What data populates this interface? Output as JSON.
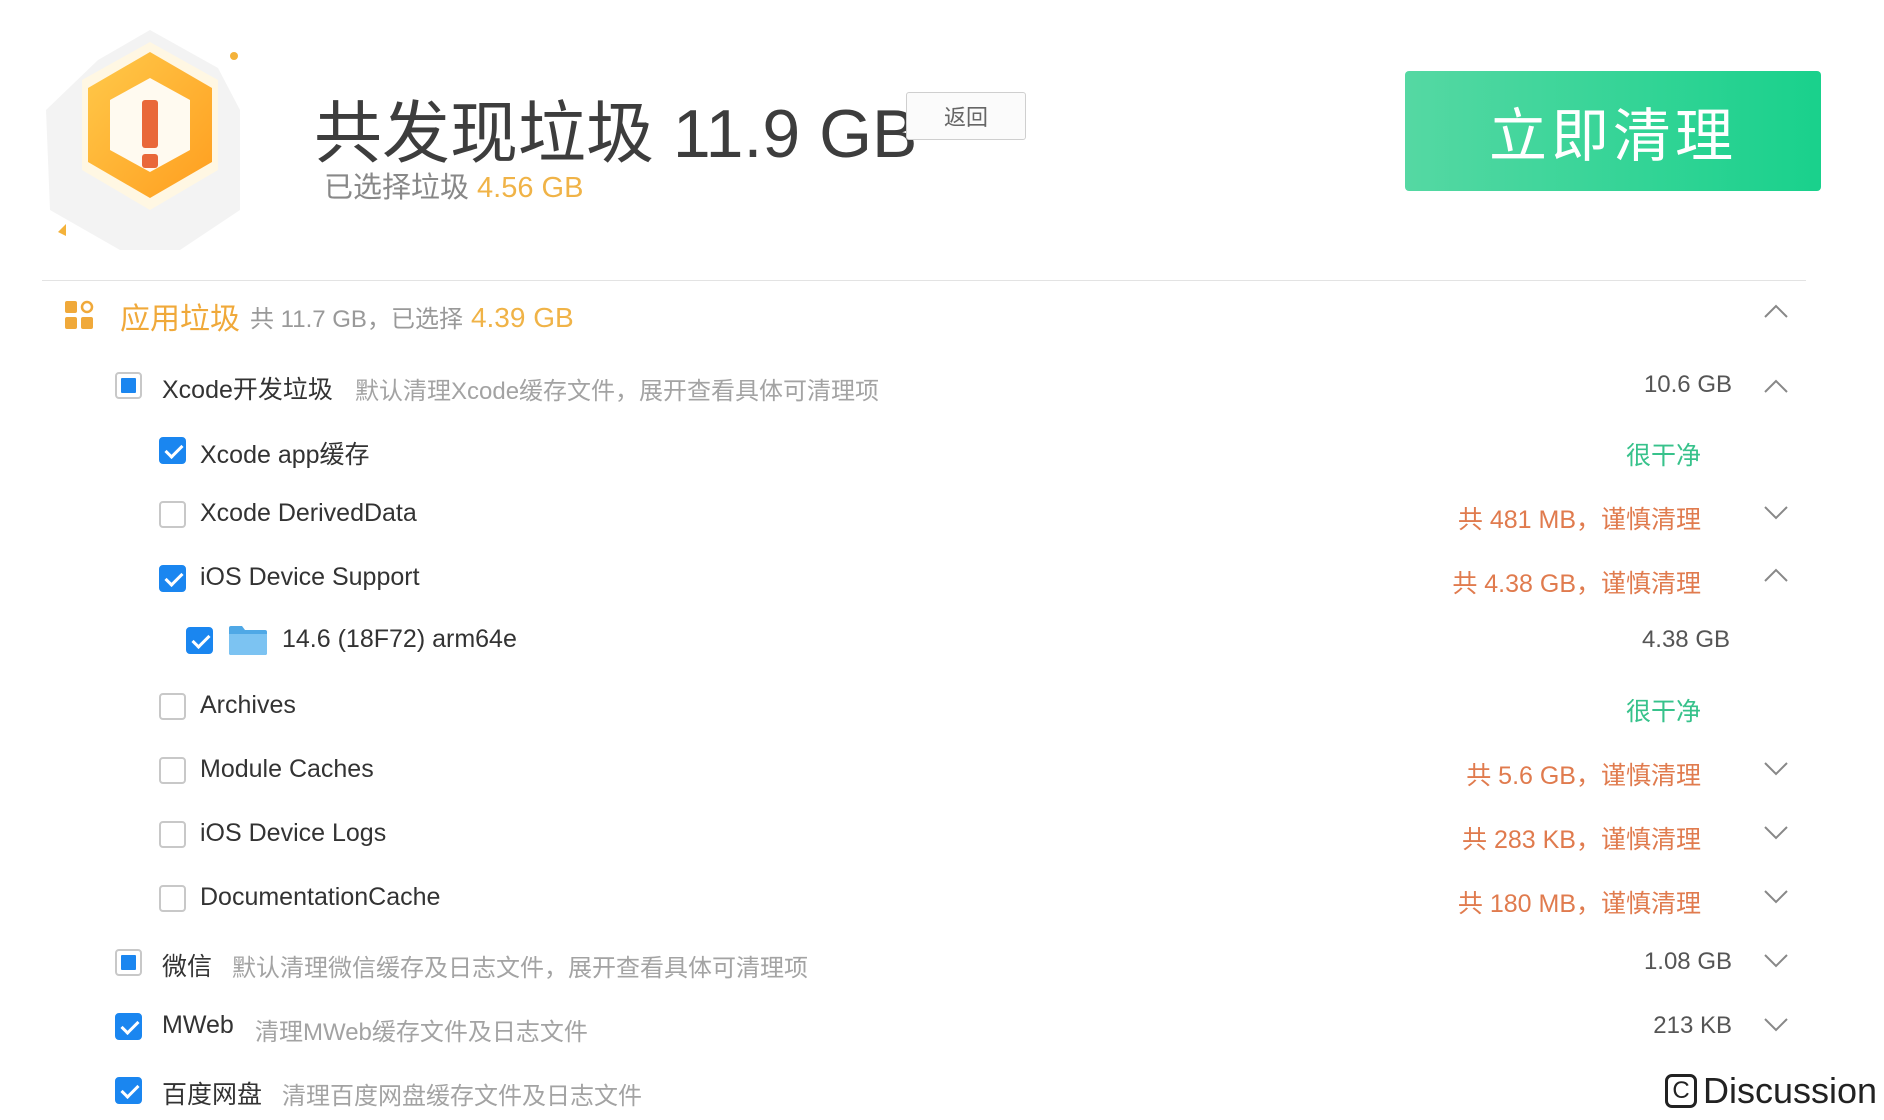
{
  "header": {
    "title": "共发现垃圾 11.9 GB",
    "back_label": "返回",
    "selected_label": "已选择垃圾",
    "selected_amount": "4.56 GB",
    "clean_label": "立即清理"
  },
  "section": {
    "title": "应用垃圾",
    "meta": "共 11.7 GB，已选择",
    "selected_amount": "4.39 GB"
  },
  "rows": {
    "xcode": {
      "label": "Xcode开发垃圾",
      "desc": "默认清理Xcode缓存文件，展开查看具体可清理项",
      "size": "10.6 GB",
      "check": "mixed"
    },
    "xcode_app_cache": {
      "label": "Xcode app缓存",
      "status": "很干净",
      "check": "checked"
    },
    "derived_data": {
      "label": "Xcode DerivedData",
      "status": "共 481 MB，谨慎清理",
      "check": "unchecked"
    },
    "device_support": {
      "label": "iOS Device Support",
      "status": "共 4.38 GB，谨慎清理",
      "check": "checked"
    },
    "device_support_item": {
      "label": "14.6 (18F72) arm64e",
      "size": "4.38 GB",
      "check": "checked"
    },
    "archives": {
      "label": "Archives",
      "status": "很干净",
      "check": "unchecked"
    },
    "module_caches": {
      "label": "Module Caches",
      "status": "共 5.6 GB，谨慎清理",
      "check": "unchecked"
    },
    "device_logs": {
      "label": "iOS Device Logs",
      "status": "共 283 KB，谨慎清理",
      "check": "unchecked"
    },
    "doc_cache": {
      "label": "DocumentationCache",
      "status": "共 180 MB，谨慎清理",
      "check": "unchecked"
    },
    "wechat": {
      "label": "微信",
      "desc": "默认清理微信缓存及日志文件，展开查看具体可清理项",
      "size": "1.08 GB",
      "check": "mixed"
    },
    "mweb": {
      "label": "MWeb",
      "desc": "清理MWeb缓存文件及日志文件",
      "size": "213 KB",
      "check": "checked"
    },
    "baidu": {
      "label": "百度网盘",
      "desc": "清理百度网盘缓存文件及日志文件",
      "check": "checked"
    }
  },
  "watermark": {
    "icon": "C",
    "text": "Discussion"
  },
  "colors": {
    "accent_orange": "#f0a93a",
    "accent_green": "#19d18c",
    "warn": "#e07b4e",
    "clean": "#37c28b",
    "checkbox_blue": "#1a86f0"
  },
  "icons": [
    "warning-hexagon-icon",
    "app-grid-icon",
    "chevron-up-icon",
    "chevron-down-icon",
    "folder-icon",
    "checkbox"
  ]
}
